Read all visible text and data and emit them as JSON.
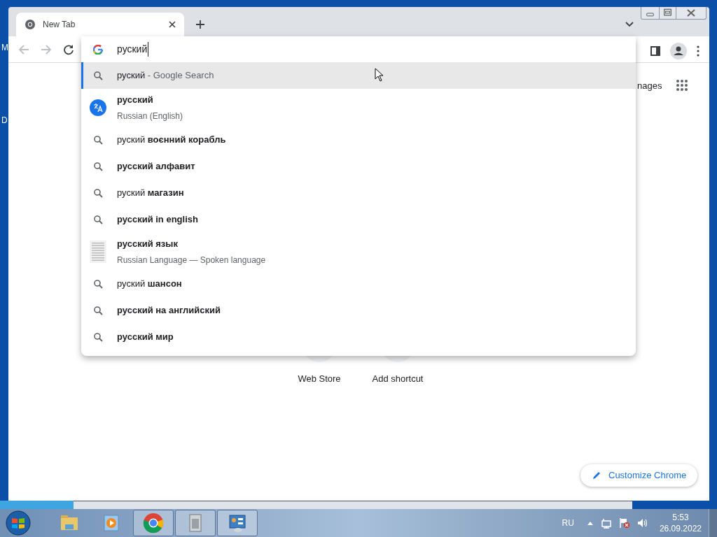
{
  "desktop_labels": [
    "M",
    "D"
  ],
  "tabs": [
    {
      "title": "New Tab",
      "selected": true
    }
  ],
  "omnibox": {
    "value": "руский"
  },
  "suggestions": [
    {
      "kind": "search",
      "selected": true,
      "query": "руский",
      "suffix": "- Google Search"
    },
    {
      "kind": "answer",
      "selected": false,
      "completion": "русский",
      "detail": "Russian (English)"
    },
    {
      "kind": "search",
      "selected": false,
      "query": "руский",
      "completion": "воєнний корабль"
    },
    {
      "kind": "search",
      "selected": false,
      "completion": "русский алфавит"
    },
    {
      "kind": "search",
      "selected": false,
      "query": "руский",
      "completion": "магазин"
    },
    {
      "kind": "search",
      "selected": false,
      "completion": "русский in english"
    },
    {
      "kind": "entity",
      "selected": false,
      "completion": "русский язык",
      "detail": "Russian Language — Spoken language"
    },
    {
      "kind": "search",
      "selected": false,
      "query": "руский",
      "completion": "шансон"
    },
    {
      "kind": "search",
      "selected": false,
      "completion": "русский на английский"
    },
    {
      "kind": "search",
      "selected": false,
      "completion": "русский мир"
    }
  ],
  "new_tab_page": {
    "header_link": "nages",
    "shortcuts": [
      "Web Store",
      "Add shortcut"
    ],
    "customize_button": "Customize Chrome"
  },
  "taskbar": {
    "apps": [
      {
        "kind": "explorer",
        "running": false
      },
      {
        "kind": "media",
        "running": false
      },
      {
        "kind": "chrome",
        "running": true
      },
      {
        "kind": "archive",
        "running": true
      },
      {
        "kind": "panel",
        "running": true
      }
    ],
    "language": "RU",
    "time": "5:53",
    "date": "26.09.2022"
  }
}
